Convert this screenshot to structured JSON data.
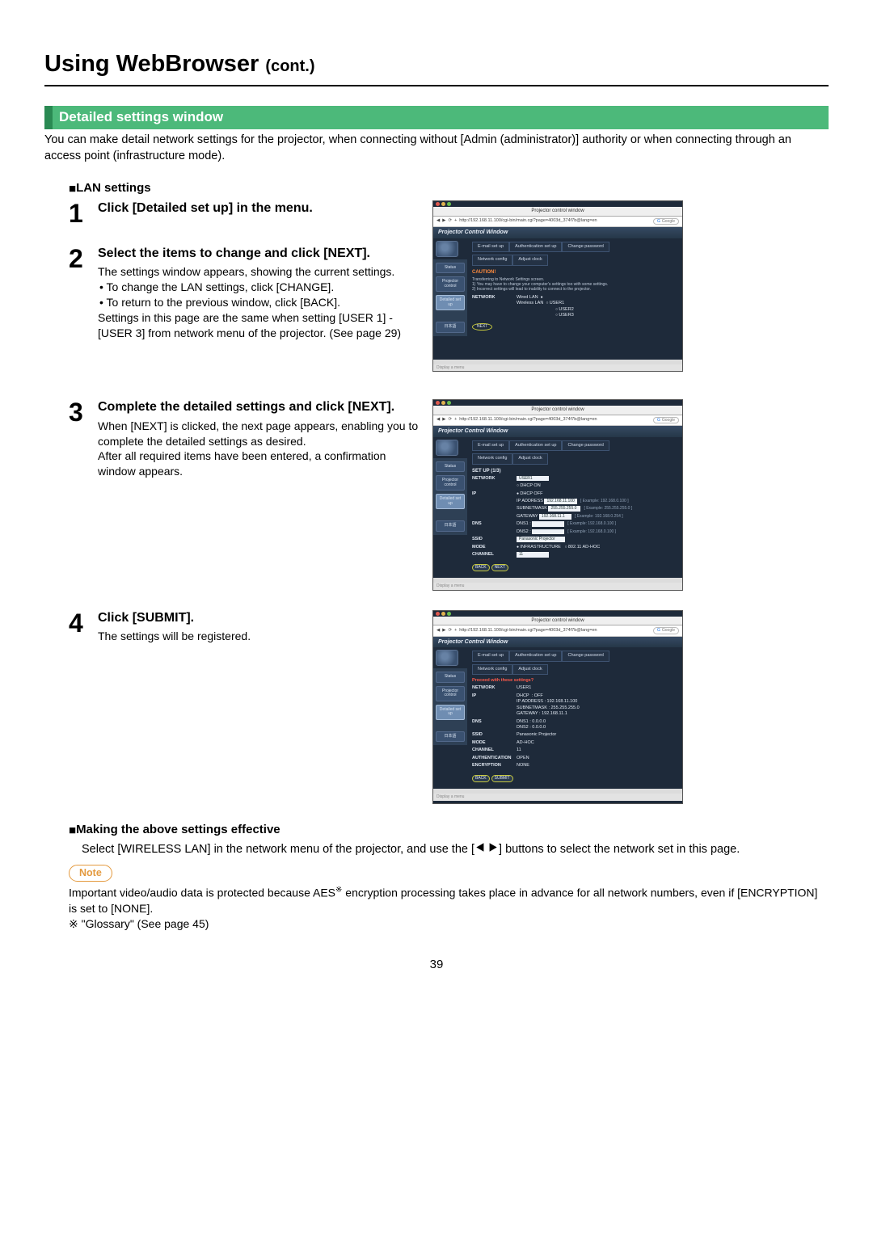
{
  "page": {
    "title_main": "Using WebBrowser ",
    "title_cont": "(cont.)",
    "section_header": "Detailed settings window",
    "intro": "You can make detail network settings for the projector, when connecting without [Admin (administrator)] authority or when connecting through an access point (infrastructure mode).",
    "lan_heading": "LAN settings",
    "making_heading": "Making the above settings effective",
    "making_body_a": "Select [WIRELESS LAN] in the network menu of the projector, and use the [",
    "making_body_b": "] buttons to select the network set in this page.",
    "note_label": "Note",
    "note_body_1a": "Important video/audio data is protected because AES",
    "note_body_1b": " encryption processing takes place in advance for all network numbers, even if [ENCRYPTION] is set to [NONE].",
    "note_body_2": "※ \"Glossary\" (See page 45)",
    "page_number": "39"
  },
  "steps": {
    "s1": {
      "num": "1",
      "head": "Click [Detailed set up] in the menu."
    },
    "s2": {
      "num": "2",
      "head": "Select the items to change and click [NEXT].",
      "d1": "The settings window appears, showing the current settings.",
      "d2": "• To change the LAN settings, click [CHANGE].",
      "d3": "• To return to the previous window, click [BACK].",
      "d4": "Settings in this page are the same when setting [USER 1] - [USER 3] from network menu of the projector. (See page 29)"
    },
    "s3": {
      "num": "3",
      "head": "Complete the detailed settings and click [NEXT].",
      "d1": "When [NEXT] is clicked, the next page appears, enabling you to complete the detailed settings as desired.",
      "d2": "After all required items have been entered, a confirmation window appears."
    },
    "s4": {
      "num": "4",
      "head": "Click [SUBMIT].",
      "d1": "The settings will be registered."
    }
  },
  "shot_common": {
    "window_title": "Projector control window",
    "url": "http://192.168.11.100/cgi-bin/main.cgi?page=4003d_374f7b@lang=en",
    "search_ph": "Google",
    "panel_title": "Projector Control Window",
    "tabs1": [
      "E-mail set up",
      "Authentication set up",
      "Change password"
    ],
    "tabs2": [
      "Network config",
      "Adjust clock"
    ],
    "sidebar": [
      "Status",
      "Projector control",
      "Detailed set up",
      "日本語"
    ]
  },
  "shot1": {
    "caution": "CAUTION!",
    "warn1": "Transferring to Network Settings screen.",
    "warn2": "1) You may have to change your computer's settings too with some settings.",
    "warn3": "2) Incorrect settings will lead to inability to connect to the projector.",
    "rows": {
      "network": "NETWORK",
      "wired": "Wired LAN",
      "wireless": "Wireless LAN",
      "u1": "USER1",
      "u2": "USER2",
      "u3": "USER3"
    },
    "btn": "NEXT"
  },
  "shot2": {
    "setup": "SET UP (1/3)",
    "rows": {
      "network": "NETWORK",
      "network_v": "USER1",
      "dhcpon": "DHCP ON",
      "dhcpoff": "DHCP OFF",
      "ip": "IP",
      "ipaddr": "IP ADDRESS",
      "ipaddr_v": "192.168.11.100",
      "ipaddr_ex": "[ Example: 192.168.0.100 ]",
      "subnet": "SUBNETMASK",
      "subnet_v": "255.255.255.0",
      "subnet_ex": "[ Example: 255.255.255.0 ]",
      "gateway": "GATEWAY",
      "gateway_v": "192.168.11.1",
      "gateway_ex": "[ Example: 192.168.0.254 ]",
      "dns": "DNS",
      "dns1": "DNS1 :",
      "dns1_ex": "[ Example: 192.168.0.100 ]",
      "dns2": "DNS2 :",
      "dns2_ex": "[ Example: 192.168.0.100 ]",
      "ssid": "SSID",
      "ssid_v": "Panasonic Projector",
      "mode": "MODE",
      "mode_a": "INFRASTRUCTURE",
      "mode_b": "802.11 AD-HOC",
      "channel": "CHANNEL",
      "channel_v": "11"
    },
    "btn_back": "BACK",
    "btn_next": "NEXT"
  },
  "shot3": {
    "proceed": "Proceed with these settings?",
    "rows": {
      "network": "NETWORK",
      "network_v": "USER1",
      "ip": "IP",
      "dhcp": "DHCP",
      "dhcp_v": ": OFF",
      "ipaddr": "IP ADDRESS",
      "ipaddr_v": ": 192.168.11.100",
      "subnet": "SUBNETMASK",
      "subnet_v": ": 255.255.255.0",
      "gateway": "GATEWAY",
      "gateway_v": ": 192.168.11.1",
      "dns": "DNS",
      "dns1": "DNS1 : 0.0.0.0",
      "dns2": "DNS2 : 0.0.0.0",
      "ssid": "SSID",
      "ssid_v": "Panasonic Projector",
      "mode": "MODE",
      "mode_v": "AD-HOC",
      "channel": "CHANNEL",
      "channel_v": "11",
      "auth": "AUTHENTICATION",
      "auth_v": "OPEN",
      "enc": "ENCRYPTION",
      "enc_v": "NONE"
    },
    "btn_back": "BACK",
    "btn_submit": "SUBMIT"
  }
}
